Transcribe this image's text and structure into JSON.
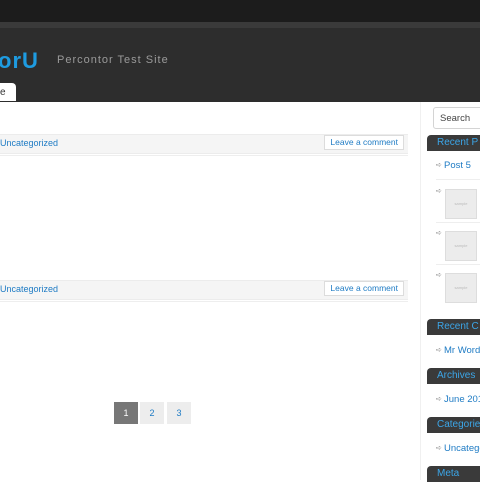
{
  "site": {
    "logo": "orU",
    "tagline": "Percontor Test Site"
  },
  "nav": {
    "tab_label": "e"
  },
  "posts": [
    {
      "category": "Uncategorized",
      "comment_label": "Leave a comment"
    },
    {
      "category": "Uncategorized",
      "comment_label": "Leave a comment"
    }
  ],
  "pagination": {
    "pages": [
      "1",
      "2",
      "3"
    ],
    "current": "1"
  },
  "sidebar": {
    "search_placeholder": "Search",
    "recent_posts": {
      "title": "Recent P",
      "first_item": "Post 5",
      "thumb_text": "sample"
    },
    "recent_comments": {
      "title": "Recent C",
      "item": "Mr Word"
    },
    "archives": {
      "title": "Archives",
      "item": "June 201"
    },
    "categories": {
      "title": "Categorie",
      "item": "Uncatego"
    },
    "meta": {
      "title": "Meta"
    }
  },
  "colors": {
    "accent": "#1e9be0",
    "link": "#1e7bc4",
    "header_bg": "#2d2d2d",
    "widget_bg": "#3a3a3a"
  }
}
